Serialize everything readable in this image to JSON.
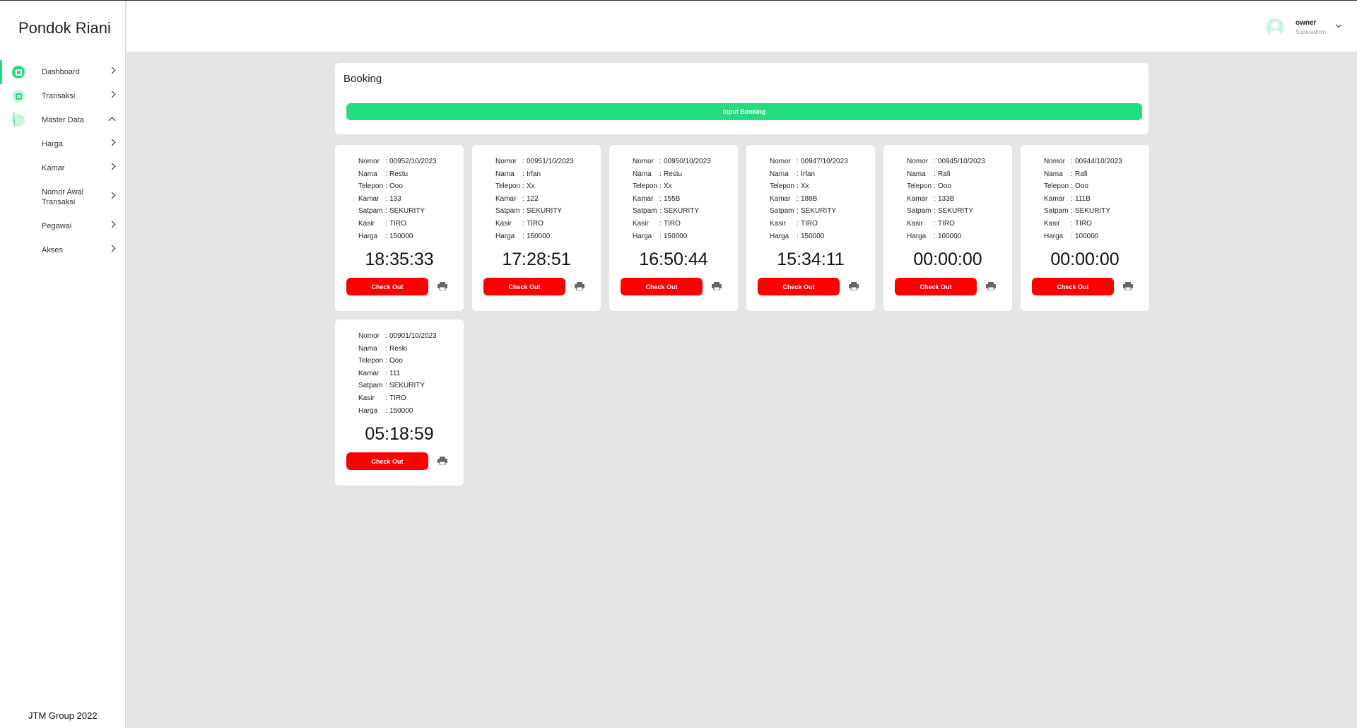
{
  "app": {
    "brand": "Pondok Riani",
    "footer": "JTM Group 2022"
  },
  "sidebar": {
    "items": [
      {
        "label": "Dashboard"
      },
      {
        "label": "Transaksi"
      },
      {
        "label": "Master Data"
      }
    ],
    "sub_items": [
      {
        "label": "Harga"
      },
      {
        "label": "Kamar"
      },
      {
        "label": "Nomor Awal Transaksi"
      },
      {
        "label": "Pegawai"
      },
      {
        "label": "Akses"
      }
    ]
  },
  "user": {
    "name": "owner",
    "role": "Superadmin"
  },
  "booking": {
    "title": "Booking",
    "input_label": "Input Booking"
  },
  "field_labels": {
    "nomor": "Nomor",
    "nama": "Nama",
    "telepon": "Telepon",
    "kamar": "Kamar",
    "satpam": "Satpam",
    "kasir": "Kasir",
    "harga": "Harga",
    "sep": ":"
  },
  "check_out_label": "Check Out",
  "cards": [
    {
      "nomor": "00952/10/2023",
      "nama": "Restu",
      "telepon": "Ooo",
      "kamar": "133",
      "satpam": "SEKURITY",
      "kasir": "TIRO",
      "harga": "150000",
      "timer": "18:35:33"
    },
    {
      "nomor": "00951/10/2023",
      "nama": "Irfan",
      "telepon": "Xx",
      "kamar": "122",
      "satpam": "SEKURITY",
      "kasir": "TIRO",
      "harga": "150000",
      "timer": "17:28:51"
    },
    {
      "nomor": "00950/10/2023",
      "nama": "Restu",
      "telepon": "Xx",
      "kamar": "155B",
      "satpam": "SEKURITY",
      "kasir": "TIRO",
      "harga": "150000",
      "timer": "16:50:44"
    },
    {
      "nomor": "00947/10/2023",
      "nama": "Irfan",
      "telepon": "Xx",
      "kamar": "188B",
      "satpam": "SEKURITY",
      "kasir": "TIRO",
      "harga": "150000",
      "timer": "15:34:11"
    },
    {
      "nomor": "00945/10/2023",
      "nama": "Rafi",
      "telepon": "Ooo",
      "kamar": "133B",
      "satpam": "SEKURITY",
      "kasir": "TIRO",
      "harga": "100000",
      "timer": "00:00:00"
    },
    {
      "nomor": "00944/10/2023",
      "nama": "Rafi",
      "telepon": "Ooo",
      "kamar": "111B",
      "satpam": "SEKURITY",
      "kasir": "TIRO",
      "harga": "100000",
      "timer": "00:00:00"
    },
    {
      "nomor": "00901/10/2023",
      "nama": "Reski",
      "telepon": "Ooo",
      "kamar": "111",
      "satpam": "SEKURITY",
      "kasir": "TIRO",
      "harga": "150000",
      "timer": "05:18:59"
    }
  ],
  "colors": {
    "accent": "#22dd7e",
    "danger": "#ff0000"
  },
  "icons": {
    "dashboard": "dashboard-icon",
    "transaksi": "receipt-icon",
    "master": "bracket-icon",
    "print": "printer-icon",
    "user": "user-avatar-icon"
  }
}
